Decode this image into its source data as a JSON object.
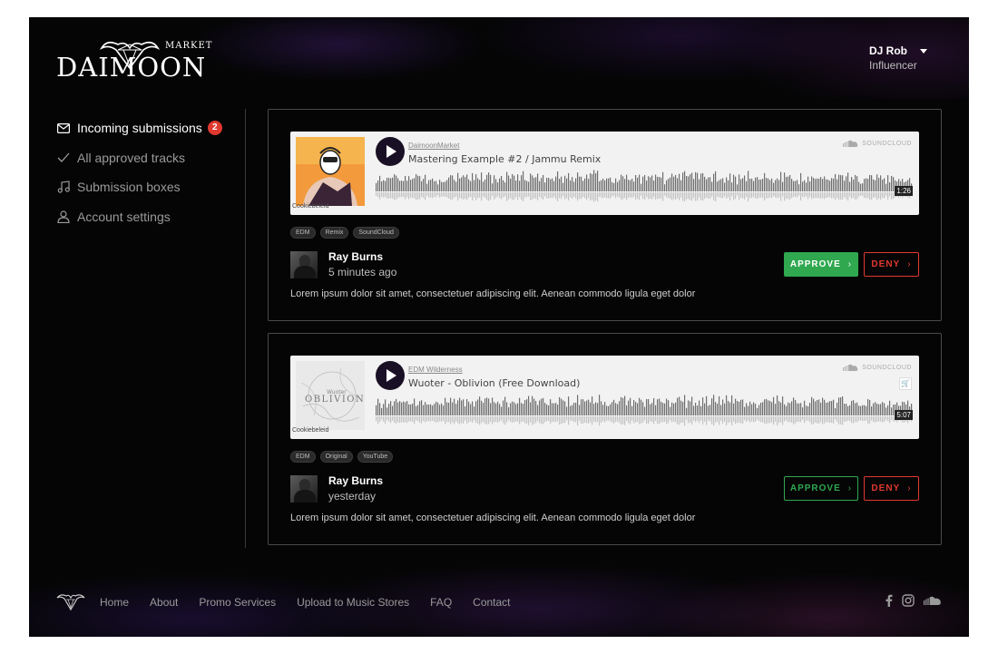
{
  "brand": {
    "name": "DAIMOON",
    "sub": "MARKET"
  },
  "user": {
    "name": "DJ Rob",
    "role": "Influencer"
  },
  "sidebar": {
    "items": [
      {
        "label": "Incoming submissions",
        "badge": "2",
        "icon": "envelope-icon",
        "active": true
      },
      {
        "label": "All approved tracks",
        "icon": "check-icon",
        "active": false
      },
      {
        "label": "Submission boxes",
        "icon": "music-note-icon",
        "active": false
      },
      {
        "label": "Account settings",
        "icon": "user-icon",
        "active": false
      }
    ]
  },
  "submissions": [
    {
      "player": {
        "artist": "DaimoonMarket",
        "title": "Mastering Example #2 / Jammu Remix",
        "brand": "SOUNDCLOUD",
        "duration": "1:26",
        "art_credit": "Cookiebeleid"
      },
      "tags": [
        "EDM",
        "Remix",
        "SoundCloud"
      ],
      "submitter": {
        "name": "Ray Burns",
        "time": "5 minutes ago"
      },
      "description": "Lorem ipsum dolor sit amet, consectetuer adipiscing elit. Aenean commodo ligula eget dolor",
      "approve_label": "APPROVE",
      "deny_label": "DENY",
      "approve_style": "filled"
    },
    {
      "player": {
        "artist": "EDM Wilderness",
        "title": "Wuoter - Oblivion (Free Download)",
        "brand": "SOUNDCLOUD",
        "duration": "5:07",
        "art_credit": "Cookiebeleid",
        "art_text": "OBLIVION"
      },
      "tags": [
        "EDM",
        "Original",
        "YouTube"
      ],
      "submitter": {
        "name": "Ray Burns",
        "time": "yesterday"
      },
      "description": "Lorem ipsum dolor sit amet, consectetuer adipiscing elit. Aenean commodo ligula eget dolor",
      "approve_label": "APPROVE",
      "deny_label": "DENY",
      "approve_style": "outline"
    }
  ],
  "footer": {
    "links": [
      "Home",
      "About",
      "Promo Services",
      "Upload to Music Stores",
      "FAQ",
      "Contact"
    ],
    "socials": [
      "facebook-icon",
      "instagram-icon",
      "soundcloud-icon"
    ]
  },
  "colors": {
    "approve": "#2fa84f",
    "deny": "#e0392f",
    "badge": "#e0392f",
    "background": "#050506"
  }
}
